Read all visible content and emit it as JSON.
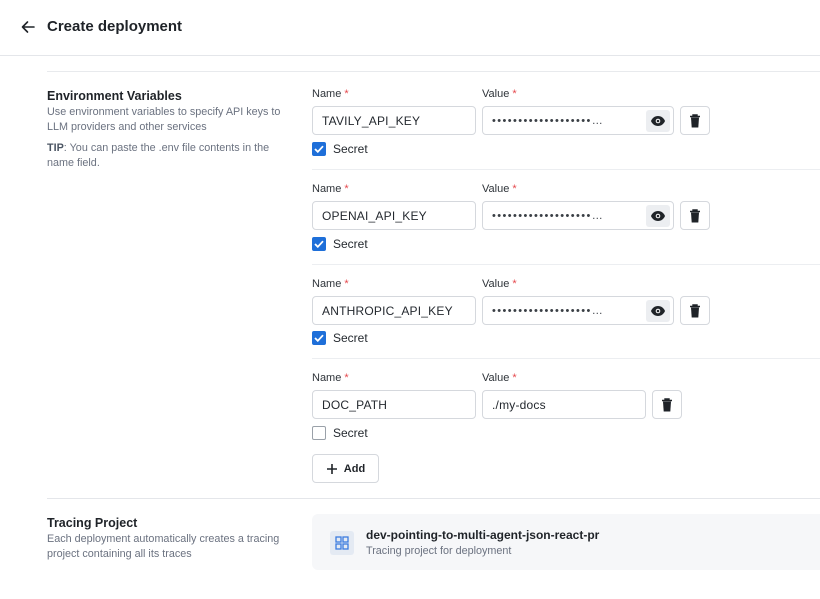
{
  "header": {
    "title": "Create deployment",
    "back_icon": "arrow-left-icon"
  },
  "env": {
    "title": "Environment Variables",
    "description": "Use environment variables to specify API keys to LLM providers and other services",
    "tip_label": "TIP",
    "tip_text": ": You can paste the .env file contents in the name field.",
    "name_label": "Name",
    "value_label": "Value",
    "required_mark": "*",
    "secret_label": "Secret",
    "rows": [
      {
        "name": "TAVILY_API_KEY",
        "value": "•••••••••••••••••••…",
        "secret": true
      },
      {
        "name": "OPENAI_API_KEY",
        "value": "•••••••••••••••••••…",
        "secret": true
      },
      {
        "name": "ANTHROPIC_API_KEY",
        "value": "•••••••••••••••••••…",
        "secret": true
      },
      {
        "name": "DOC_PATH",
        "value": "./my-docs",
        "secret": false
      }
    ],
    "add_label": "Add"
  },
  "tracing": {
    "title": "Tracing Project",
    "description": "Each deployment automatically creates a tracing project containing all its traces",
    "project_name": "dev-pointing-to-multi-agent-json-react-pr",
    "project_subtitle": "Tracing project for deployment"
  },
  "colors": {
    "accent": "#1e6fd9",
    "required": "#e5484d",
    "muted": "#6b7280"
  }
}
